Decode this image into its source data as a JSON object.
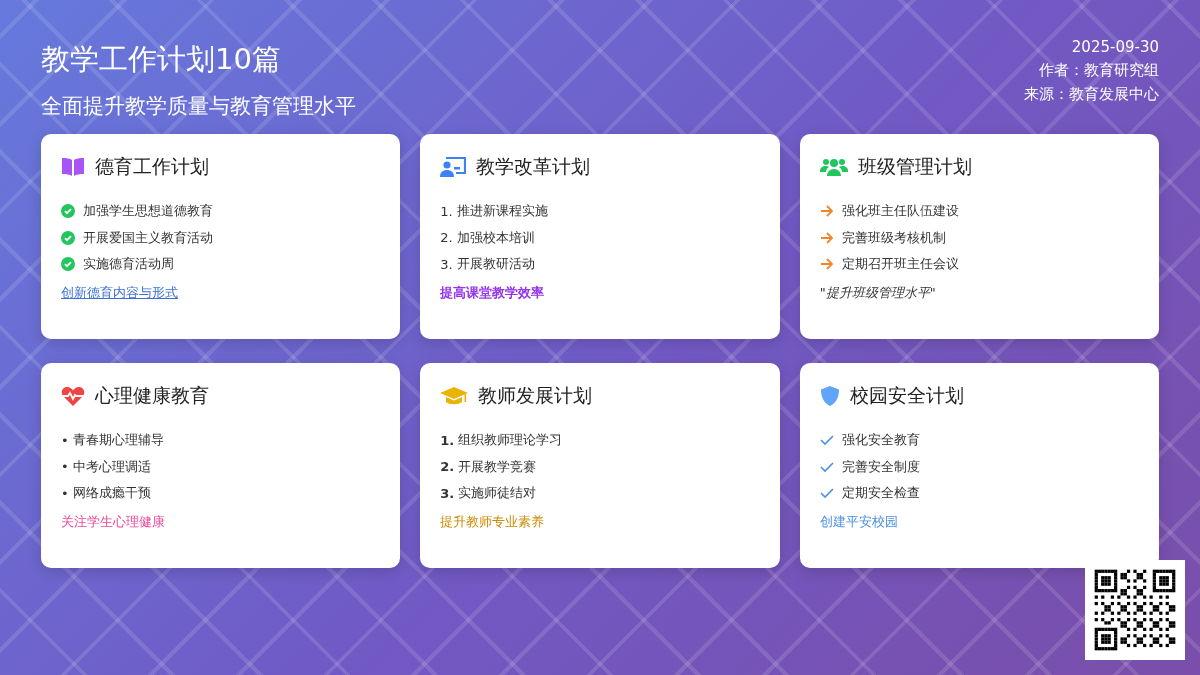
{
  "header": {
    "title": "教学工作计划10篇",
    "subtitle": "全面提升教学质量与教育管理水平",
    "date": "2025-09-30",
    "author": "作者：教育研究组",
    "source": "来源：教育发展中心"
  },
  "cards": [
    {
      "title": "德育工作计划",
      "kind": "check-circle",
      "items": [
        {
          "text": "加强学生思想道德教育"
        },
        {
          "text": "开展爱国主义教育活动"
        },
        {
          "text": "实施德育活动周"
        }
      ],
      "footer": {
        "kind": "link",
        "text": "创新德育内容与形式",
        "color": "#3b6fd4"
      }
    },
    {
      "title": "教学改革计划",
      "kind": "text",
      "items": [
        {
          "mark": "1.",
          "text": "推进新课程实施"
        },
        {
          "mark": "2.",
          "text": "加强校本培训"
        },
        {
          "mark": "3.",
          "text": "开展教研活动"
        }
      ],
      "footer": {
        "kind": "bold",
        "text": "提高课堂教学效率",
        "color": "#9333ea"
      }
    },
    {
      "title": "班级管理计划",
      "kind": "arrow",
      "items": [
        {
          "text": "强化班主任队伍建设"
        },
        {
          "text": "完善班级考核机制"
        },
        {
          "text": "定期召开班主任会议"
        }
      ],
      "footer": {
        "kind": "quote",
        "text": "\"*提升班级管理水平*\"",
        "color": "#333333"
      }
    },
    {
      "title": "心理健康教育",
      "kind": "text",
      "items": [
        {
          "mark": "•",
          "text": "青春期心理辅导"
        },
        {
          "mark": "•",
          "text": "中考心理调适"
        },
        {
          "mark": "•",
          "text": "网络成瘾干预"
        }
      ],
      "footer": {
        "kind": "plain",
        "text": "关注学生心理健康",
        "color": "#ec4899"
      }
    },
    {
      "title": "教师发展计划",
      "kind": "bold-text",
      "items": [
        {
          "mark": "1.",
          "text": "组织教师理论学习"
        },
        {
          "mark": "2.",
          "text": "开展教学竞赛"
        },
        {
          "mark": "3.",
          "text": "实施师徒结对"
        }
      ],
      "footer": {
        "kind": "plain",
        "text": "提升教师专业素养",
        "color": "#ca8a04"
      }
    },
    {
      "title": "校园安全计划",
      "kind": "tick",
      "items": [
        {
          "text": "强化安全教育"
        },
        {
          "text": "完善安全制度"
        },
        {
          "text": "定期安全检查"
        }
      ],
      "footer": {
        "kind": "plain",
        "text": "创建平安校园",
        "color": "#4a90e2"
      }
    }
  ]
}
